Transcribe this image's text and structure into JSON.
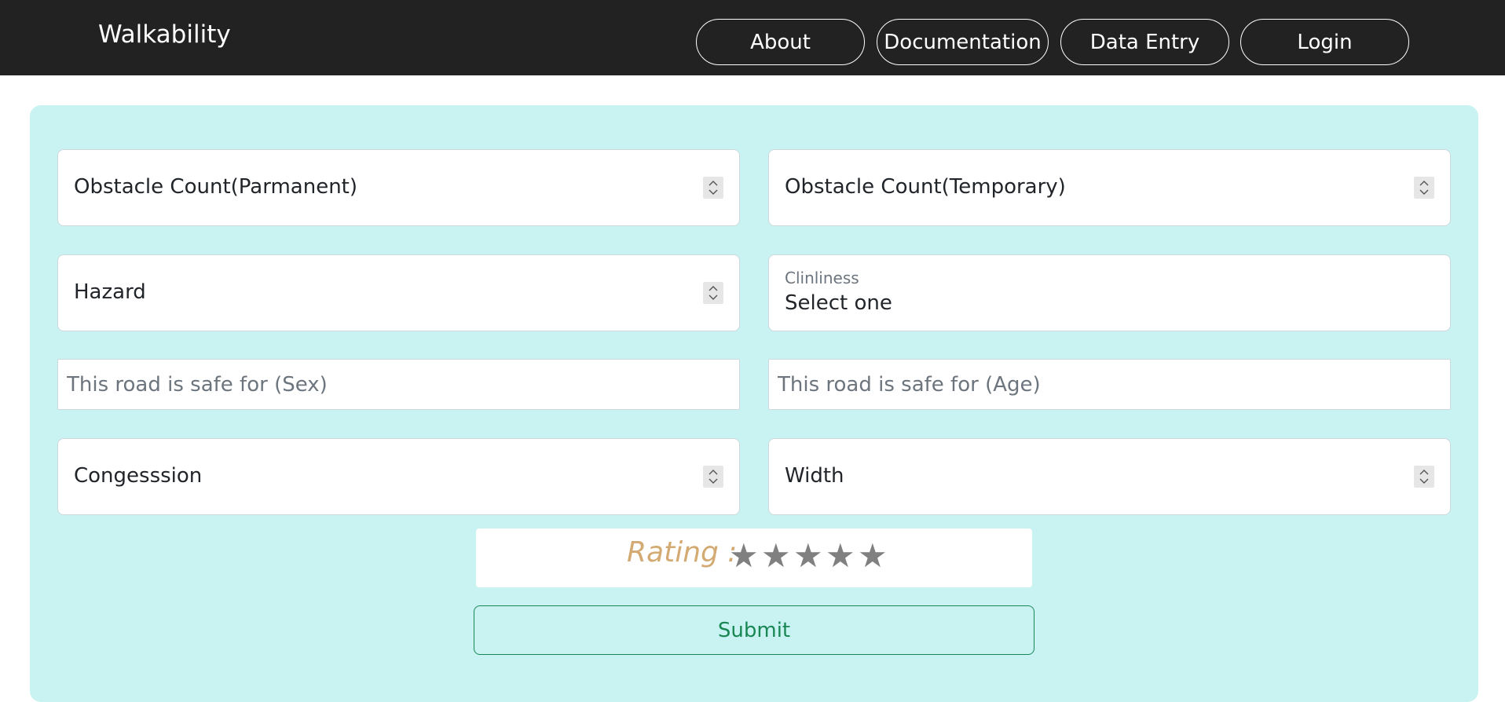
{
  "nav": {
    "brand": "Walkability",
    "items": [
      {
        "label": "About"
      },
      {
        "label": "Documentation"
      },
      {
        "label": "Data Entry"
      },
      {
        "label": "Login"
      }
    ]
  },
  "form": {
    "obstacle_permanent": {
      "label": "Obstacle Count(Parmanent)"
    },
    "obstacle_temporary": {
      "label": "Obstacle Count(Temporary)"
    },
    "hazard": {
      "label": "Hazard"
    },
    "cleanliness": {
      "label": "Clinliness",
      "value": "Select one"
    },
    "safe_sex": {
      "placeholder": "This road is safe for (Sex)"
    },
    "safe_age": {
      "placeholder": "This road is safe for (Age)"
    },
    "congestion": {
      "label": "Congesssion"
    },
    "width": {
      "label": "Width"
    },
    "rating": {
      "label": "Rating :",
      "stars": [
        "★",
        "★",
        "★",
        "★",
        "★"
      ],
      "value": 0,
      "max": 5
    },
    "submit_label": "Submit"
  },
  "colors": {
    "navbar": "#222222",
    "card": "#c9f3f2",
    "rating_label": "#d4aa73",
    "star": "#808080",
    "submit": "#198754"
  }
}
